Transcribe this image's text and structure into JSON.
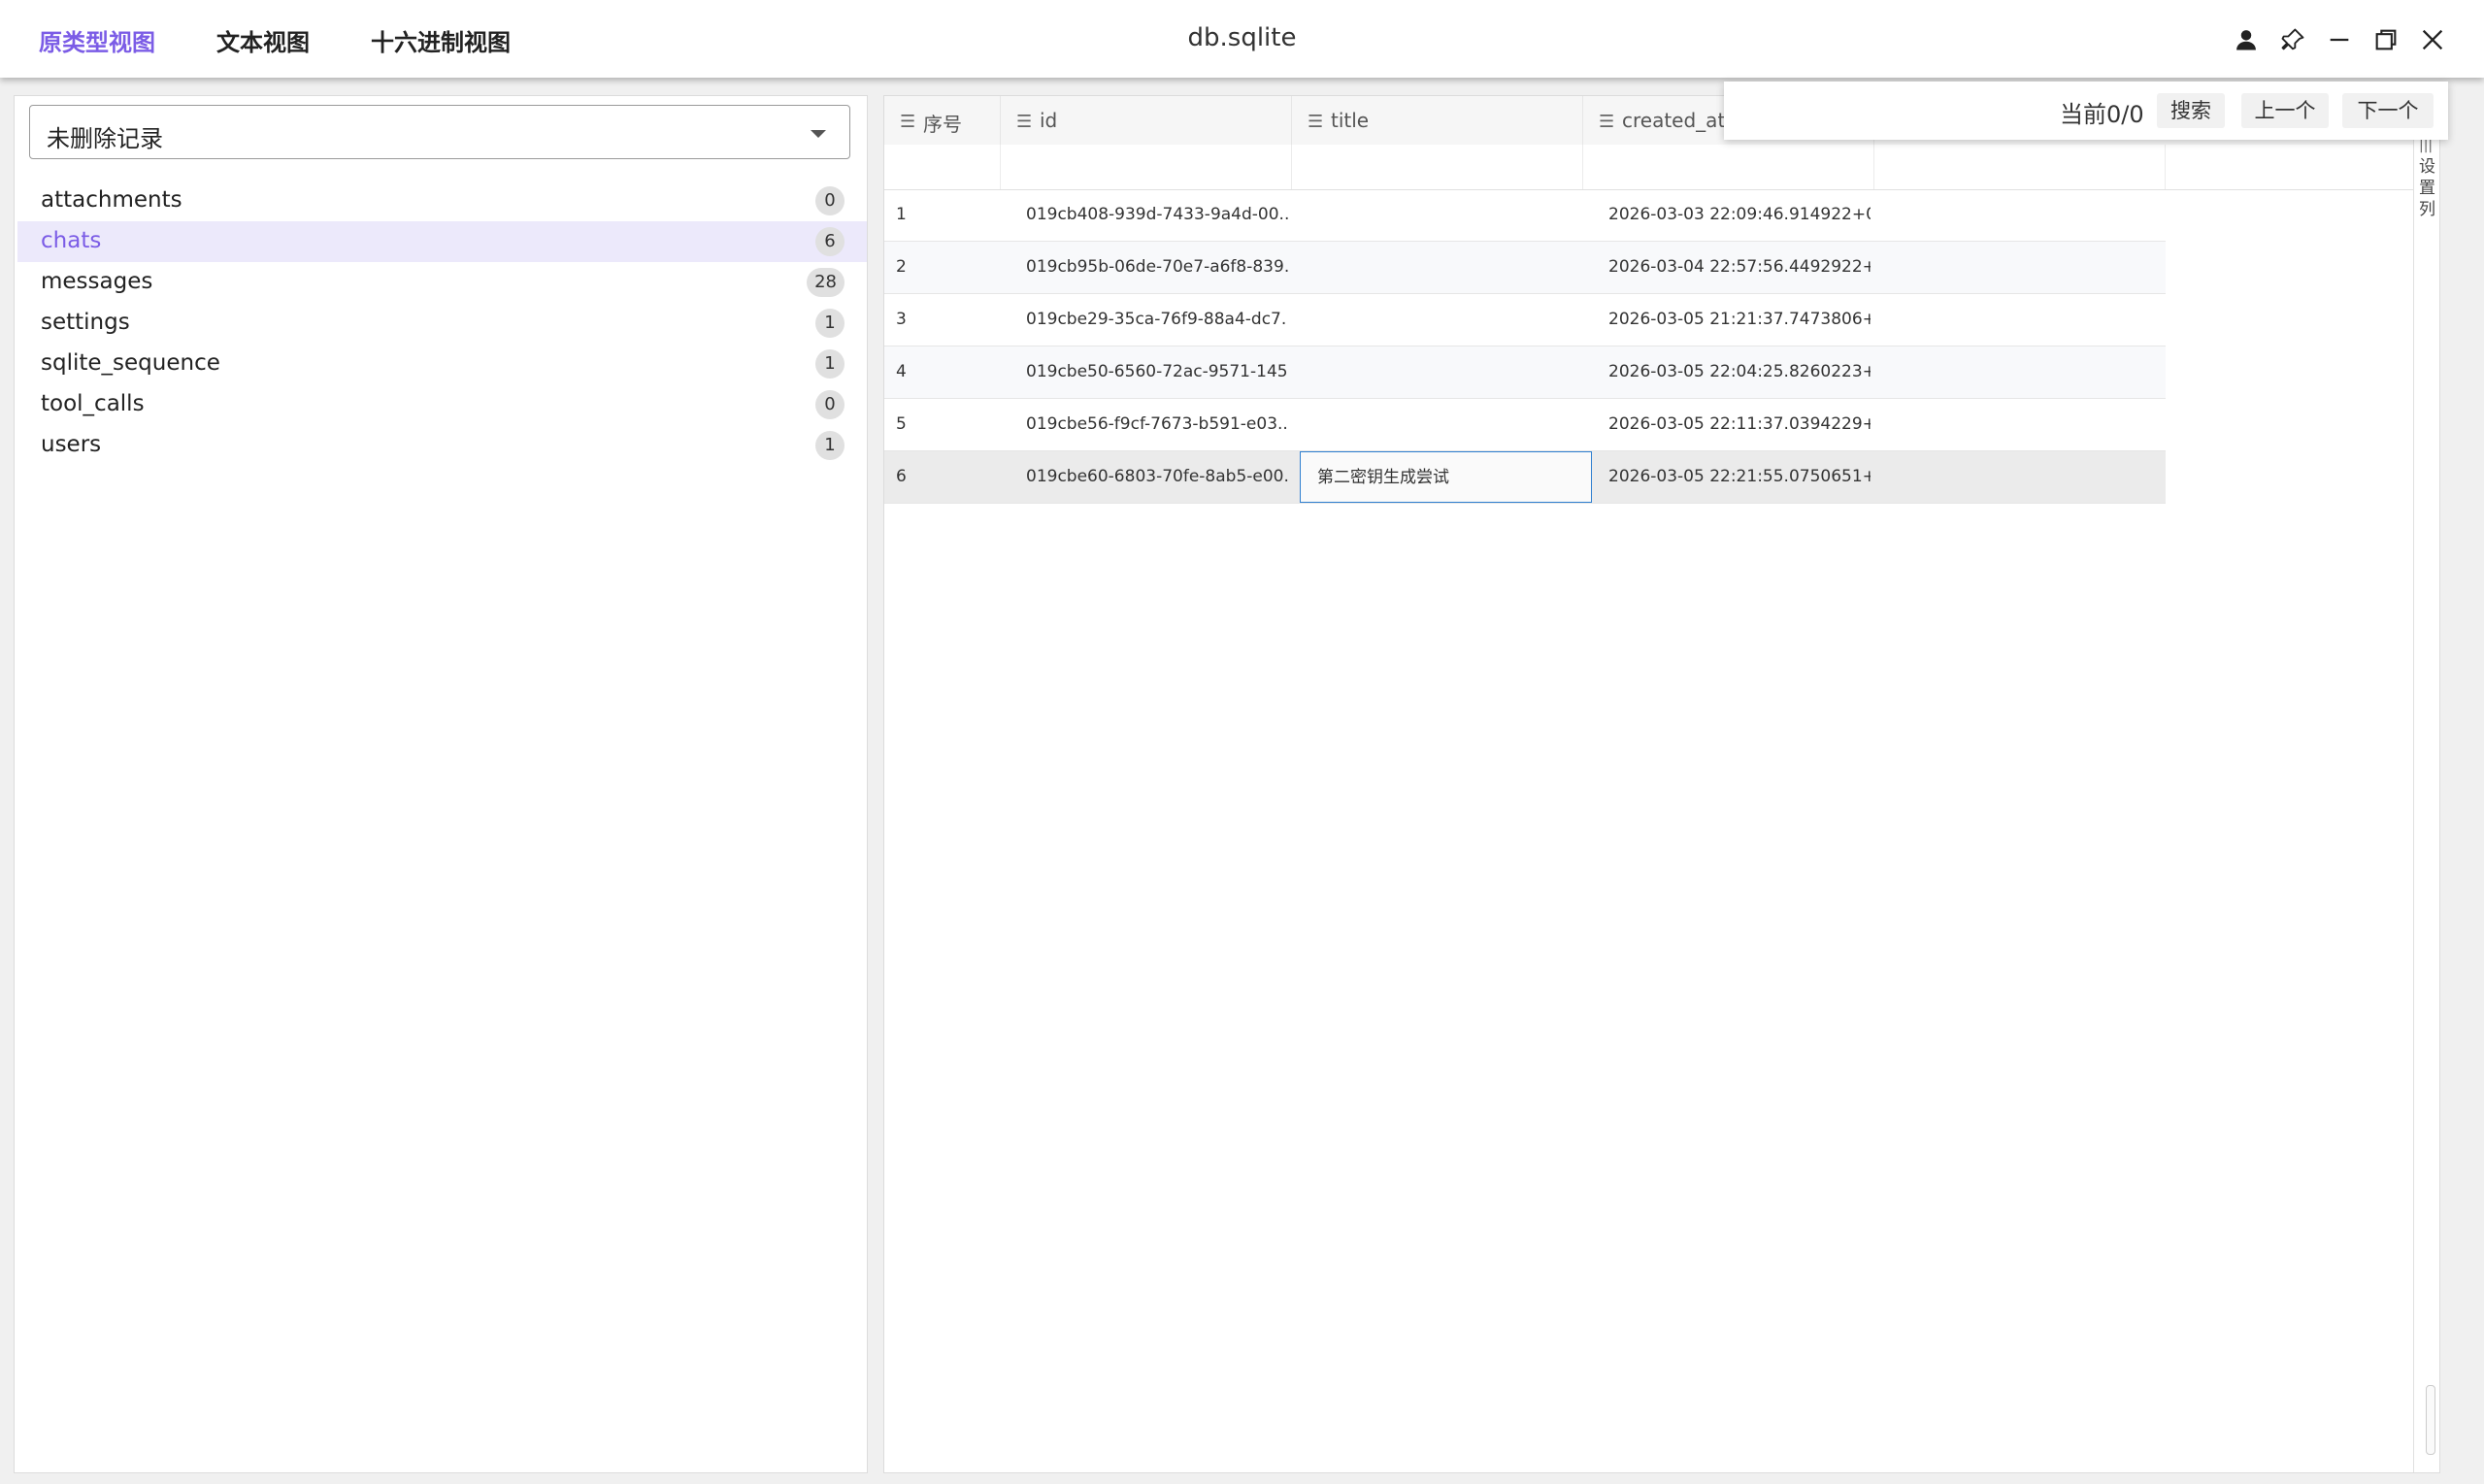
{
  "header": {
    "tabs": [
      {
        "label": "原类型视图",
        "active": true
      },
      {
        "label": "文本视图",
        "active": false
      },
      {
        "label": "十六进制视图",
        "active": false
      }
    ],
    "window_title": "db.sqlite",
    "controls": [
      "user-icon",
      "pin-icon",
      "minimize-icon",
      "restore-icon",
      "close-icon"
    ]
  },
  "sidebar": {
    "filter_value": "未删除记录",
    "tables": [
      {
        "name": "attachments",
        "count": "0"
      },
      {
        "name": "chats",
        "count": "6"
      },
      {
        "name": "messages",
        "count": "28"
      },
      {
        "name": "settings",
        "count": "1"
      },
      {
        "name": "sqlite_sequence",
        "count": "1"
      },
      {
        "name": "tool_calls",
        "count": "0"
      },
      {
        "name": "users",
        "count": "1"
      }
    ],
    "selected": "chats"
  },
  "grid": {
    "columns": [
      {
        "label": "序号",
        "icon": "menu-icon"
      },
      {
        "label": "id",
        "icon": "menu-icon"
      },
      {
        "label": "title",
        "icon": "menu-icon"
      },
      {
        "label": "created_at",
        "icon": "menu-icon"
      }
    ],
    "rows": [
      {
        "seq": "1",
        "id": "019cb408-939d-7433-9a4d-00...",
        "title": "",
        "created_at": "2026-03-03 22:09:46.914922+0..."
      },
      {
        "seq": "2",
        "id": "019cb95b-06de-70e7-a6f8-839...",
        "title": "",
        "created_at": "2026-03-04 22:57:56.4492922+..."
      },
      {
        "seq": "3",
        "id": "019cbe29-35ca-76f9-88a4-dc7...",
        "title": "",
        "created_at": "2026-03-05 21:21:37.7473806+..."
      },
      {
        "seq": "4",
        "id": "019cbe50-6560-72ac-9571-145...",
        "title": "",
        "created_at": "2026-03-05 22:04:25.8260223+..."
      },
      {
        "seq": "5",
        "id": "019cbe56-f9cf-7673-b591-e03...",
        "title": "",
        "created_at": "2026-03-05 22:11:37.0394229+..."
      },
      {
        "seq": "6",
        "id": "019cbe60-6803-70fe-8ab5-e00...",
        "title": "第二密钥生成尝试",
        "created_at": "2026-03-05 22:21:55.0750651+..."
      }
    ],
    "selected_row": 6,
    "settings_label": "设置列",
    "settings_icon": "columns-icon"
  },
  "search": {
    "status": "当前0/0",
    "search_label": "搜索",
    "prev_label": "上一个",
    "next_label": "下一个"
  },
  "colors": {
    "accent": "#7b5ce6",
    "selected_bg": "#ece9fb",
    "edit_border": "#2f7fd0"
  }
}
